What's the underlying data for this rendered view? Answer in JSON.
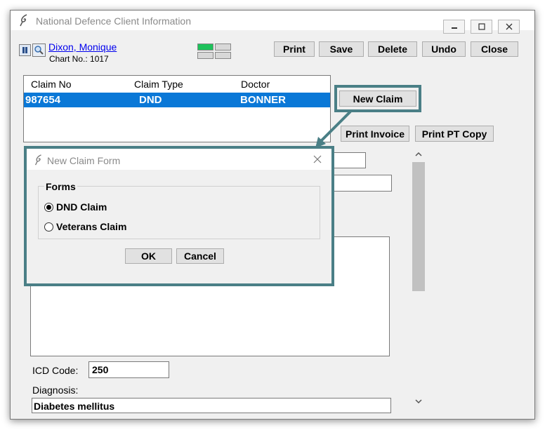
{
  "window": {
    "title": "National Defence Client Information",
    "controls": [
      "minimize-icon",
      "maximize-icon",
      "close-icon"
    ]
  },
  "patient": {
    "name": "Dixon, Monique",
    "chart_no": "Chart No.: 1017"
  },
  "toolbar": {
    "print": "Print",
    "save": "Save",
    "delete": "Delete",
    "undo": "Undo",
    "close": "Close"
  },
  "claims_table": {
    "columns": [
      "Claim No",
      "Claim Type",
      "Doctor"
    ],
    "rows": [
      {
        "claim_no": "987654",
        "claim_type": "DND",
        "doctor": "BONNER",
        "selected": true
      }
    ]
  },
  "actions": {
    "new_claim": "New Claim",
    "print_invoice": "Print Invoice",
    "print_pt_copy": "Print PT Copy"
  },
  "form": {
    "icd_code_label": "ICD Code:",
    "icd_code_value": "250",
    "diagnosis_label": "Diagnosis:",
    "diagnosis_value": "Diabetes mellitus"
  },
  "dialog": {
    "title": "New Claim Form",
    "group_label": "Forms",
    "options": [
      {
        "label": "DND Claim",
        "checked": true
      },
      {
        "label": "Veterans Claim",
        "checked": false
      }
    ],
    "ok": "OK",
    "cancel": "Cancel"
  },
  "colors": {
    "selection": "#0a78d7",
    "highlight": "#4a7f86",
    "status_green": "#1ec15a"
  }
}
